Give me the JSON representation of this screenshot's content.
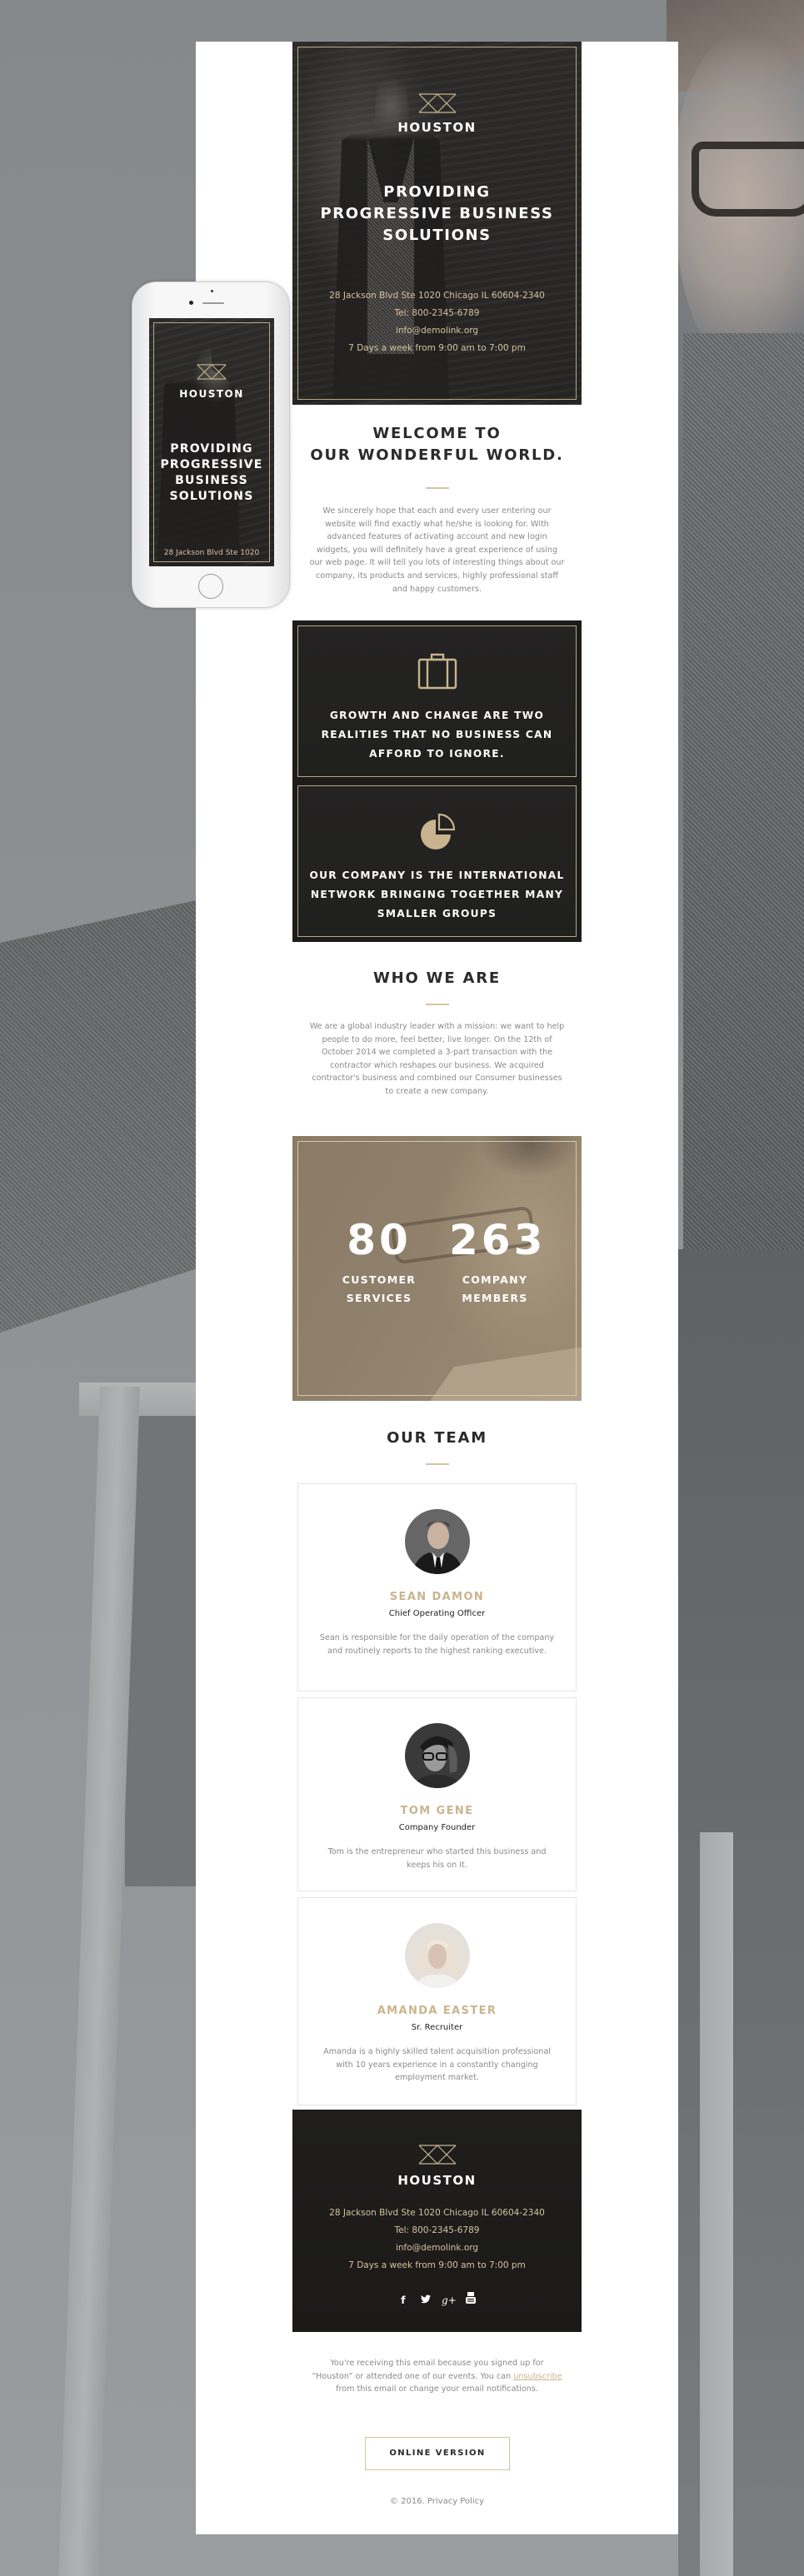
{
  "brand": {
    "name": "HOUSTON",
    "accent_color": "#c9b48f",
    "dark_color": "#1d1c1b"
  },
  "hero": {
    "title": "PROVIDING PROGRESSIVE BUSINESS SOLUTIONS",
    "address": "28 Jackson Blvd Ste 1020 Chicago IL 60604-2340",
    "phone": "Tel: 800-2345-6789",
    "email": "info@demolink.org",
    "hours": "7 Days a week from 9:00 am to 7:00 pm"
  },
  "mobile_preview": {
    "brand": "HOUSTON",
    "title": "PROVIDING PROGRESSIVE BUSINESS SOLUTIONS",
    "address_partial": "28 Jackson Blvd Ste 1020"
  },
  "welcome": {
    "title": "WELCOME TO OUR WONDERFUL WORLD.",
    "text": "We sincerely hope that each and every user entering our website will find exactly what he/she is looking for. With advanced features of activating account and new login widgets, you will definitely have a great experience of using our web page. It will tell you lots of interesting things about our company, its products and services, highly professional staff and happy customers."
  },
  "features": [
    {
      "icon": "briefcase-icon",
      "text": "GROWTH AND CHANGE ARE TWO REALITIES THAT NO BUSINESS CAN AFFORD TO IGNORE."
    },
    {
      "icon": "pie-chart-icon",
      "text": "OUR COMPANY IS THE INTERNATIONAL NETWORK BRINGING TOGETHER MANY SMALLER GROUPS"
    }
  ],
  "who_we_are": {
    "title": "WHO WE ARE",
    "text": "We are a global industry leader with a mission: we want to help people to do more, feel better, live longer. On the 12th of October 2014 we completed a 3-part transaction with the contractor which reshapes our business. We acquired contractor's business and combined our Consumer businesses to create a new company."
  },
  "stats": [
    {
      "value": "80",
      "label": "CUSTOMER SERVICES"
    },
    {
      "value": "263",
      "label": "COMPANY MEMBERS"
    }
  ],
  "team": {
    "title": "OUR TEAM",
    "members": [
      {
        "name": "SEAN DAMON",
        "role": "Chief Operating Officer",
        "bio": "Sean is responsible for the daily operation of the company and routinely reports to the highest ranking executive."
      },
      {
        "name": "TOM GENE",
        "role": "Company Founder",
        "bio": "Tom is the entrepreneur who started this business and keeps his on it."
      },
      {
        "name": "AMANDA EASTER",
        "role": "Sr. Recruiter",
        "bio": "Amanda is a highly skilled talent acquisition professional with 10 years experience in a constantly changing employment market."
      }
    ]
  },
  "footer": {
    "brand": "HOUSTON",
    "address": "28 Jackson Blvd Ste 1020 Chicago IL 60604-2340",
    "phone": "Tel: 800-2345-6789",
    "email": "info@demolink.org",
    "hours": "7 Days a week from 9:00 am to 7:00 pm",
    "socials": [
      {
        "icon": "facebook-icon",
        "glyph": "f"
      },
      {
        "icon": "twitter-icon",
        "glyph": "t"
      },
      {
        "icon": "google-plus-icon",
        "glyph": "g+"
      },
      {
        "icon": "youtube-icon",
        "glyph": "▶"
      }
    ],
    "note_before": "You're receiving this email because you signed up for “Houston” or attended one of our events. You can",
    "unsubscribe_label": "unsubscribe",
    "note_after": "from this email or change your email notifications.",
    "online_version_label": "ONLINE VERSION",
    "copyright": "© 2016.",
    "privacy_label": "Privacy Policy"
  }
}
